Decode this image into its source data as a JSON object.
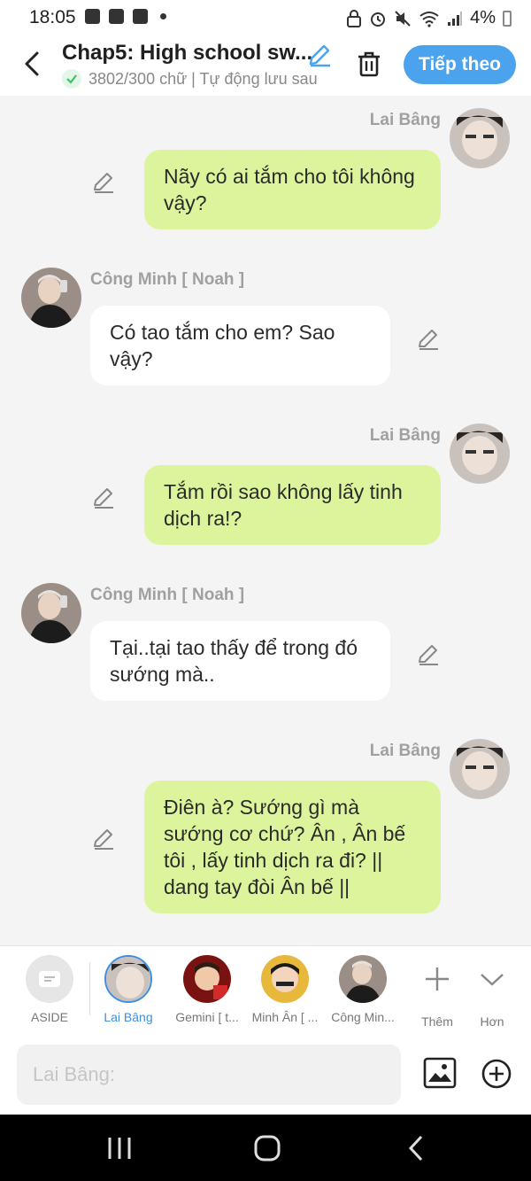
{
  "status": {
    "time": "18:05",
    "battery": "4%"
  },
  "header": {
    "title": "Chap5: High school sw...",
    "subtitle": "3802/300 chữ | Tự động lưu sau",
    "next_label": "Tiếp theo"
  },
  "messages": [
    {
      "sender": "Lai Bâng",
      "side": "right",
      "text": "Nãy có ai tắm cho tôi không vậy?"
    },
    {
      "sender": "Công Minh [ Noah ]",
      "side": "left",
      "text": "Có tao tắm cho em? Sao vậy?"
    },
    {
      "sender": "Lai Bâng",
      "side": "right",
      "text": "Tắm rồi sao không lấy tinh dịch ra!?"
    },
    {
      "sender": "Công Minh [ Noah ]",
      "side": "left",
      "text": "Tại..tại tao thấy để trong đó sướng mà.."
    },
    {
      "sender": "Lai Bâng",
      "side": "right",
      "text": "Điên à? Sướng gì mà sướng cơ chứ? Ân , Ân bế tôi , lấy tinh dịch ra đi? || dang tay đòi Ân bế ||"
    }
  ],
  "characters": [
    {
      "label": "ASIDE"
    },
    {
      "label": "Lai Bâng"
    },
    {
      "label": "Gemini [ t..."
    },
    {
      "label": "Minh Ân [ ..."
    },
    {
      "label": "Công Min..."
    },
    {
      "label": "Thêm"
    },
    {
      "label": "Hơn"
    }
  ],
  "input": {
    "placeholder": "Lai Bâng:"
  },
  "colors": {
    "accent": "#4aa3ec",
    "my_bubble": "#dcf59c",
    "selected_char": "#3d8fe0"
  }
}
